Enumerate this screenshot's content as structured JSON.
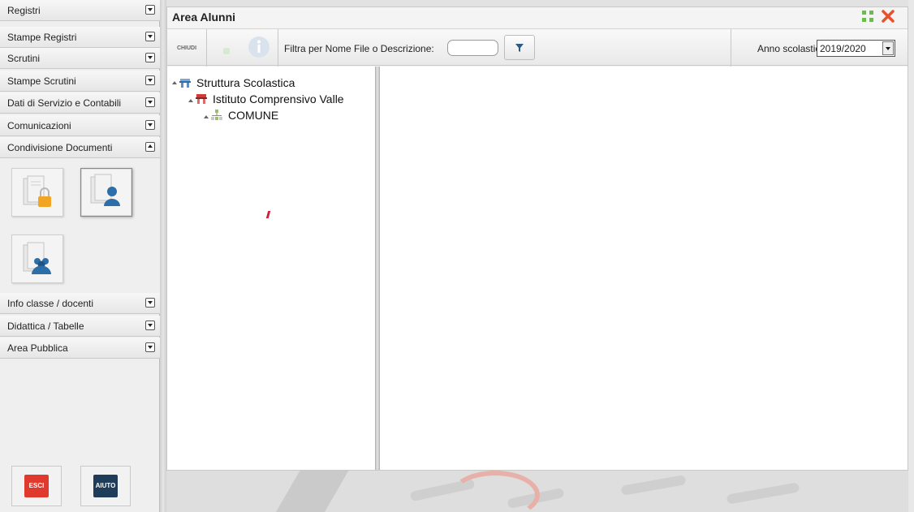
{
  "sidebar": {
    "items_top": [
      {
        "label": "Registri",
        "state": "collapsed"
      },
      {
        "label": "Stampe Registri",
        "state": "collapsed"
      },
      {
        "label": "Scrutini",
        "state": "collapsed"
      },
      {
        "label": "Stampe Scrutini",
        "state": "collapsed"
      },
      {
        "label": "Dati di Servizio e Contabili",
        "state": "collapsed"
      },
      {
        "label": "Comunicazioni",
        "state": "collapsed"
      },
      {
        "label": "Condivisione Documenti",
        "state": "expanded"
      }
    ],
    "tiles": [
      {
        "icon": "documents-lock-icon",
        "selected": false
      },
      {
        "icon": "documents-user-icon",
        "selected": true
      },
      {
        "icon": "documents-group-icon",
        "selected": false
      }
    ],
    "items_bottom": [
      {
        "label": "Info classe / docenti",
        "state": "collapsed"
      },
      {
        "label": "Didattica / Tabelle",
        "state": "collapsed"
      },
      {
        "label": "Area Pubblica",
        "state": "collapsed"
      }
    ],
    "buttons": {
      "exit_label": "ESCI",
      "help_label": "AIUTO"
    }
  },
  "window": {
    "title": "Area Alunni",
    "toolbar": {
      "close_label": "CHIUDI",
      "filter_label": "Filtra per Nome File o Descrizione:",
      "filter_value": "",
      "year_label": "Anno scolastico:",
      "year_value": "2019/2020"
    },
    "tree": {
      "nodes": [
        {
          "label": "Struttura Scolastica",
          "level": 0,
          "icon": "school-structure-icon"
        },
        {
          "label": "Istituto Comprensivo Valle",
          "level": 1,
          "icon": "institute-icon"
        },
        {
          "label": "COMUNE",
          "level": 2,
          "icon": "org-chart-icon"
        }
      ]
    }
  },
  "colors": {
    "exit_button": "#e03a2f",
    "help_button": "#1f3c5a",
    "close_icon": "#e8512c",
    "maximize_icon": "#6dbb4b",
    "filter_icon": "#2c5a85"
  }
}
